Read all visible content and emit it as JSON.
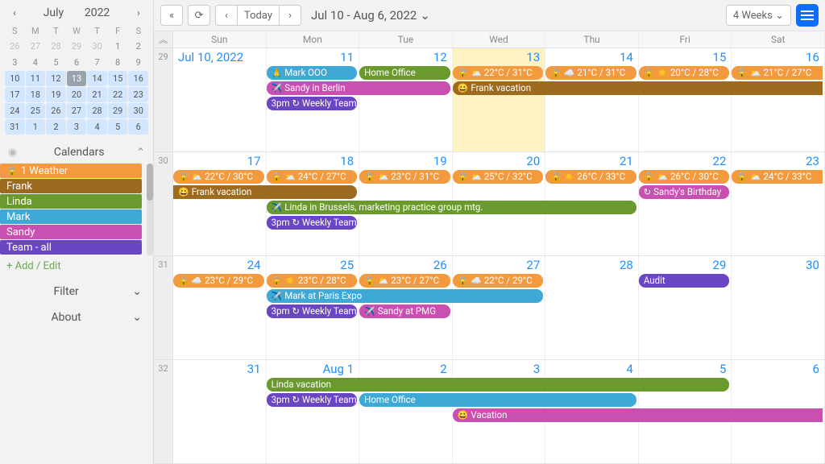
{
  "mini": {
    "month": "July",
    "year": "2022",
    "dow": [
      "S",
      "M",
      "T",
      "W",
      "T",
      "F",
      "S"
    ],
    "days": [
      {
        "n": "26",
        "cls": "outside"
      },
      {
        "n": "27",
        "cls": "outside"
      },
      {
        "n": "28",
        "cls": "outside"
      },
      {
        "n": "29",
        "cls": "outside"
      },
      {
        "n": "30",
        "cls": "outside"
      },
      {
        "n": "1",
        "cls": ""
      },
      {
        "n": "2",
        "cls": ""
      },
      {
        "n": "3",
        "cls": ""
      },
      {
        "n": "4",
        "cls": ""
      },
      {
        "n": "5",
        "cls": ""
      },
      {
        "n": "6",
        "cls": ""
      },
      {
        "n": "7",
        "cls": ""
      },
      {
        "n": "8",
        "cls": ""
      },
      {
        "n": "9",
        "cls": ""
      },
      {
        "n": "10",
        "cls": "in-range"
      },
      {
        "n": "11",
        "cls": "in-range"
      },
      {
        "n": "12",
        "cls": "in-range"
      },
      {
        "n": "13",
        "cls": "in-range today"
      },
      {
        "n": "14",
        "cls": "in-range"
      },
      {
        "n": "15",
        "cls": "in-range"
      },
      {
        "n": "16",
        "cls": "in-range"
      },
      {
        "n": "17",
        "cls": "in-range"
      },
      {
        "n": "18",
        "cls": "in-range"
      },
      {
        "n": "19",
        "cls": "in-range"
      },
      {
        "n": "20",
        "cls": "in-range"
      },
      {
        "n": "21",
        "cls": "in-range"
      },
      {
        "n": "22",
        "cls": "in-range"
      },
      {
        "n": "23",
        "cls": "in-range"
      },
      {
        "n": "24",
        "cls": "in-range"
      },
      {
        "n": "25",
        "cls": "in-range"
      },
      {
        "n": "26",
        "cls": "in-range"
      },
      {
        "n": "27",
        "cls": "in-range"
      },
      {
        "n": "28",
        "cls": "in-range"
      },
      {
        "n": "29",
        "cls": "in-range"
      },
      {
        "n": "30",
        "cls": "in-range"
      },
      {
        "n": "31",
        "cls": "in-range"
      },
      {
        "n": "1",
        "cls": "in-range"
      },
      {
        "n": "2",
        "cls": "in-range"
      },
      {
        "n": "3",
        "cls": "in-range"
      },
      {
        "n": "4",
        "cls": "in-range"
      },
      {
        "n": "5",
        "cls": "in-range"
      },
      {
        "n": "6",
        "cls": "in-range"
      }
    ]
  },
  "sidebar": {
    "calendars_title": "Calendars",
    "add_edit": "+ Add / Edit",
    "filter": "Filter",
    "about": "About",
    "items": [
      {
        "label": "1 Weather",
        "color": "#f39a3e",
        "lock": true
      },
      {
        "label": "Frank",
        "color": "#9c6b1f",
        "lock": false
      },
      {
        "label": "Linda",
        "color": "#6a9a2d",
        "lock": false
      },
      {
        "label": "Mark",
        "color": "#3ea9d6",
        "lock": false
      },
      {
        "label": "Sandy",
        "color": "#c94fb0",
        "lock": false
      },
      {
        "label": "Team - all",
        "color": "#6a46c2",
        "lock": false
      }
    ]
  },
  "toolbar": {
    "today": "Today",
    "range": "Jul 10 - Aug 6, 2022",
    "view": "4 Weeks"
  },
  "dow": [
    "Sun",
    "Mon",
    "Tue",
    "Wed",
    "Thu",
    "Fri",
    "Sat"
  ],
  "weeks": [
    {
      "num": "29",
      "days": [
        {
          "label": "Jul 10, 2022",
          "first": true
        },
        {
          "label": "11"
        },
        {
          "label": "12"
        },
        {
          "label": "13",
          "today": true
        },
        {
          "label": "14"
        },
        {
          "label": "15"
        },
        {
          "label": "16"
        }
      ],
      "events": [
        {
          "row": 0,
          "c0": 1,
          "c1": 2,
          "color": "#3ea9d6",
          "icon": "🙏",
          "text": "Mark OOO"
        },
        {
          "row": 0,
          "c0": 2,
          "c1": 3,
          "color": "#6a9a2d",
          "icon": "",
          "text": "Home Office"
        },
        {
          "row": 0,
          "c0": 3,
          "c1": 4,
          "color": "#f39a3e",
          "icon": "🔒 ⛅",
          "text": "22°C / 31°C"
        },
        {
          "row": 0,
          "c0": 4,
          "c1": 5,
          "color": "#f39a3e",
          "icon": "🔒 ☁️",
          "text": "21°C / 31°C"
        },
        {
          "row": 0,
          "c0": 5,
          "c1": 6,
          "color": "#f39a3e",
          "icon": "🔒 ☀️",
          "text": "20°C / 28°C"
        },
        {
          "row": 0,
          "c0": 6,
          "c1": 7,
          "color": "#f39a3e",
          "icon": "🔒 ⛅",
          "text": "21°C / 27°C",
          "square_r": true
        },
        {
          "row": 1,
          "c0": 1,
          "c1": 3,
          "color": "#c94fb0",
          "icon": "✈️",
          "text": "Sandy in Berlin"
        },
        {
          "row": 1,
          "c0": 3,
          "c1": 7,
          "color": "#9c6b1f",
          "icon": "😀",
          "text": "Frank vacation",
          "square_r": true
        },
        {
          "row": 2,
          "c0": 1,
          "c1": 2,
          "color": "#6a46c2",
          "icon": "",
          "text": "3pm ↻ Weekly Team"
        }
      ]
    },
    {
      "num": "30",
      "days": [
        {
          "label": "17"
        },
        {
          "label": "18"
        },
        {
          "label": "19"
        },
        {
          "label": "20"
        },
        {
          "label": "21"
        },
        {
          "label": "22"
        },
        {
          "label": "23"
        }
      ],
      "events": [
        {
          "row": 0,
          "c0": 0,
          "c1": 1,
          "color": "#f39a3e",
          "icon": "🔒 ⛅",
          "text": "22°C / 30°C"
        },
        {
          "row": 0,
          "c0": 1,
          "c1": 2,
          "color": "#f39a3e",
          "icon": "🔒 ⛅",
          "text": "24°C / 27°C"
        },
        {
          "row": 0,
          "c0": 2,
          "c1": 3,
          "color": "#f39a3e",
          "icon": "🔒 ⛅",
          "text": "23°C / 31°C"
        },
        {
          "row": 0,
          "c0": 3,
          "c1": 4,
          "color": "#f39a3e",
          "icon": "🔒 ⛅",
          "text": "25°C / 32°C"
        },
        {
          "row": 0,
          "c0": 4,
          "c1": 5,
          "color": "#f39a3e",
          "icon": "🔒 ☀️",
          "text": "26°C / 33°C"
        },
        {
          "row": 0,
          "c0": 5,
          "c1": 6,
          "color": "#f39a3e",
          "icon": "🔒 ⛅",
          "text": "26°C / 30°C"
        },
        {
          "row": 0,
          "c0": 6,
          "c1": 7,
          "color": "#f39a3e",
          "icon": "🔒 ⛅",
          "text": "24°C / 33°C",
          "square_r": true
        },
        {
          "row": 1,
          "c0": 0,
          "c1": 2,
          "color": "#9c6b1f",
          "icon": "😀",
          "text": "Frank vacation",
          "square_l": true
        },
        {
          "row": 1,
          "c0": 5,
          "c1": 6,
          "color": "#c94fb0",
          "icon": "↻",
          "text": "Sandy's Birthday"
        },
        {
          "row": 2,
          "c0": 1,
          "c1": 5,
          "color": "#6a9a2d",
          "icon": "✈️",
          "text": "Linda in Brussels, marketing practice group mtg."
        },
        {
          "row": 3,
          "c0": 1,
          "c1": 2,
          "color": "#6a46c2",
          "icon": "",
          "text": "3pm ↻ Weekly Team"
        }
      ]
    },
    {
      "num": "31",
      "days": [
        {
          "label": "24"
        },
        {
          "label": "25"
        },
        {
          "label": "26"
        },
        {
          "label": "27"
        },
        {
          "label": "28"
        },
        {
          "label": "29"
        },
        {
          "label": "30"
        }
      ],
      "events": [
        {
          "row": 0,
          "c0": 0,
          "c1": 1,
          "color": "#f39a3e",
          "icon": "🔒 ☁️",
          "text": "23°C / 29°C"
        },
        {
          "row": 0,
          "c0": 1,
          "c1": 2,
          "color": "#f39a3e",
          "icon": "🔒 ☀️",
          "text": "23°C / 28°C"
        },
        {
          "row": 0,
          "c0": 2,
          "c1": 3,
          "color": "#f39a3e",
          "icon": "🔒 ⛅",
          "text": "23°C / 27°C"
        },
        {
          "row": 0,
          "c0": 3,
          "c1": 4,
          "color": "#f39a3e",
          "icon": "🔒 ☁️",
          "text": "22°C / 29°C"
        },
        {
          "row": 0,
          "c0": 5,
          "c1": 6,
          "color": "#6a46c2",
          "icon": "",
          "text": "Audit"
        },
        {
          "row": 1,
          "c0": 1,
          "c1": 4,
          "color": "#3ea9d6",
          "icon": "✈️",
          "text": "Mark at Paris Expo"
        },
        {
          "row": 2,
          "c0": 1,
          "c1": 2,
          "color": "#6a46c2",
          "icon": "",
          "text": "3pm ↻ Weekly Team"
        },
        {
          "row": 2,
          "c0": 2,
          "c1": 3,
          "color": "#c94fb0",
          "icon": "✈️",
          "text": "Sandy at PMG"
        }
      ]
    },
    {
      "num": "32",
      "days": [
        {
          "label": "31"
        },
        {
          "label": "Aug 1",
          "month": true
        },
        {
          "label": "2"
        },
        {
          "label": "3"
        },
        {
          "label": "4"
        },
        {
          "label": "5"
        },
        {
          "label": "6"
        }
      ],
      "events": [
        {
          "row": 0,
          "c0": 1,
          "c1": 6,
          "color": "#6a9a2d",
          "icon": "",
          "text": "Linda vacation"
        },
        {
          "row": 1,
          "c0": 1,
          "c1": 2,
          "color": "#6a46c2",
          "icon": "",
          "text": "3pm ↻ Weekly Team"
        },
        {
          "row": 1,
          "c0": 2,
          "c1": 5,
          "color": "#3ea9d6",
          "icon": "",
          "text": "Home Office"
        },
        {
          "row": 2,
          "c0": 3,
          "c1": 7,
          "color": "#c94fb0",
          "icon": "😀",
          "text": "Vacation",
          "square_r": true
        }
      ]
    }
  ]
}
